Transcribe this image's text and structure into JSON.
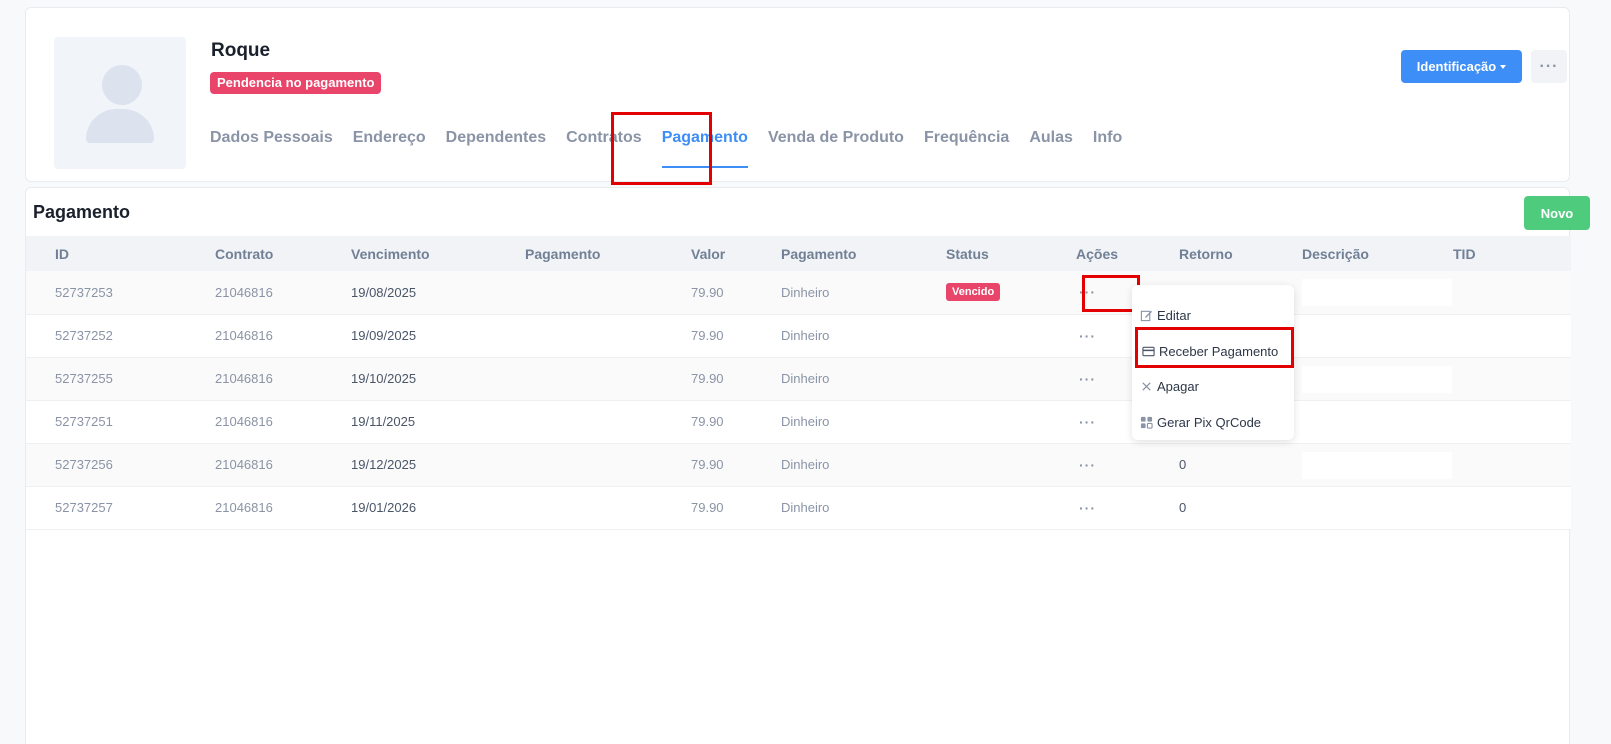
{
  "profile": {
    "name": "Roque",
    "badge": "Pendencia no pagamento",
    "identification_label": "Identificação",
    "more_label": "···"
  },
  "tabs": [
    {
      "label": "Dados Pessoais"
    },
    {
      "label": "Endereço"
    },
    {
      "label": "Dependentes"
    },
    {
      "label": "Contratos"
    },
    {
      "label": "Pagamento"
    },
    {
      "label": "Venda de Produto"
    },
    {
      "label": "Frequência"
    },
    {
      "label": "Aulas"
    },
    {
      "label": "Info"
    }
  ],
  "active_tab": "Pagamento",
  "payments": {
    "title": "Pagamento",
    "new_label": "Novo",
    "columns": [
      "ID",
      "Contrato",
      "Vencimento",
      "Pagamento",
      "Valor",
      "Pagamento",
      "Status",
      "Ações",
      "Retorno",
      "Descrição",
      "TID"
    ],
    "rows": [
      {
        "id": "52737253",
        "contract": "21046816",
        "due": "19/08/2025",
        "paid": "",
        "value": "79.90",
        "method": "Dinheiro",
        "status": "Vencido",
        "return": ""
      },
      {
        "id": "52737252",
        "contract": "21046816",
        "due": "19/09/2025",
        "paid": "",
        "value": "79.90",
        "method": "Dinheiro",
        "status": "",
        "return": ""
      },
      {
        "id": "52737255",
        "contract": "21046816",
        "due": "19/10/2025",
        "paid": "",
        "value": "79.90",
        "method": "Dinheiro",
        "status": "",
        "return": ""
      },
      {
        "id": "52737251",
        "contract": "21046816",
        "due": "19/11/2025",
        "paid": "",
        "value": "79.90",
        "method": "Dinheiro",
        "status": "",
        "return": ""
      },
      {
        "id": "52737256",
        "contract": "21046816",
        "due": "19/12/2025",
        "paid": "",
        "value": "79.90",
        "method": "Dinheiro",
        "status": "",
        "return": "0"
      },
      {
        "id": "52737257",
        "contract": "21046816",
        "due": "19/01/2026",
        "paid": "",
        "value": "79.90",
        "method": "Dinheiro",
        "status": "",
        "return": "0"
      }
    ],
    "actions_label": "···"
  },
  "dropdown": {
    "items": [
      {
        "label": "Editar",
        "icon": "edit-icon"
      },
      {
        "label": "Receber Pagamento",
        "icon": "card-icon"
      },
      {
        "label": "Apagar",
        "icon": "close-icon"
      },
      {
        "label": "Gerar Pix QrCode",
        "icon": "qrcode-icon"
      }
    ]
  },
  "colors": {
    "primary": "#3d8ef7",
    "danger": "#e9456b",
    "success": "#4fcb7e",
    "highlight": "#e30000"
  }
}
